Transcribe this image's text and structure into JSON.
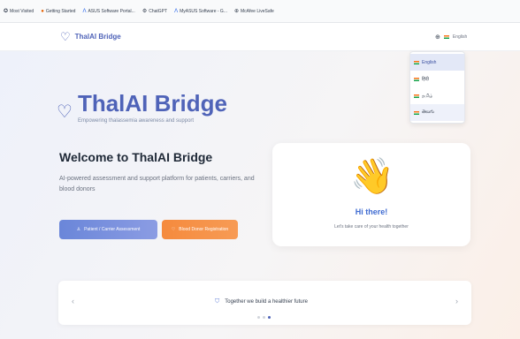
{
  "bookmarks": [
    {
      "icon": "✪",
      "label": "Most Visited"
    },
    {
      "icon": "●",
      "label": "Getting Started"
    },
    {
      "icon": "Λ",
      "label": "ASUS Software Portal..."
    },
    {
      "icon": "⚙",
      "label": "ChatGPT"
    },
    {
      "icon": "Λ",
      "label": "MyASUS Software - G..."
    },
    {
      "icon": "⊕",
      "label": "McAfee LiveSafe"
    }
  ],
  "nav": {
    "brand": "ThalAI Bridge",
    "language_button": "English"
  },
  "language_menu": {
    "items": [
      "English",
      "हिंदी",
      "தமிழ்",
      "తెలుగు"
    ],
    "active_index": 0,
    "selected_index": 3
  },
  "hero": {
    "brand": "ThalAI Bridge",
    "tagline": "Empowering thalassemia awareness and support",
    "welcome": "Welcome to ThalAI Bridge",
    "subtitle": "AI-powered assessment and support platform for patients, carriers, and blood donors",
    "assessment_button": "Patient / Carrier Assessment",
    "donor_button": "Blood Donor Registration"
  },
  "greeting_card": {
    "emoji": "👋",
    "title": "Hi there!",
    "subtitle": "Let's take care of your health together"
  },
  "carousel": {
    "text": "Together we build a healthier future",
    "prev_arrow": "‹",
    "next_arrow": "›",
    "slide_count": 3,
    "active_slide": 2
  },
  "colors": {
    "brand_blue": "#4f63b8",
    "accent_orange": "#f58a3d",
    "heading_dark": "#1f2937"
  }
}
